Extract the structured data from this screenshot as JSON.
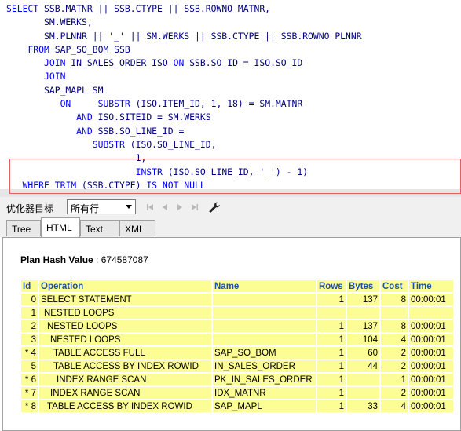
{
  "editor": {
    "lines": [
      [
        {
          "t": "SELECT ",
          "k": 1
        },
        {
          "t": "SSB.MATNR || SSB.CTYPE || SSB.ROWNO MATNR,",
          "k": 0
        }
      ],
      [
        {
          "t": "       SM.WERKS,",
          "k": 0
        }
      ],
      [
        {
          "t": "       SM.PLNNR || '_' || SM.WERKS || SSB.CTYPE || SSB.ROWNO PLNNR",
          "k": 0
        }
      ],
      [
        {
          "t": "    ",
          "k": 0
        },
        {
          "t": "FROM ",
          "k": 1
        },
        {
          "t": "SAP_SO_BOM SSB",
          "k": 0
        }
      ],
      [
        {
          "t": "       ",
          "k": 0
        },
        {
          "t": "JOIN ",
          "k": 1
        },
        {
          "t": "IN_SALES_ORDER ISO ",
          "k": 0
        },
        {
          "t": "ON ",
          "k": 1
        },
        {
          "t": "SSB.SO_ID = ISO.SO_ID",
          "k": 0
        }
      ],
      [
        {
          "t": "       ",
          "k": 0
        },
        {
          "t": "JOIN",
          "k": 1
        }
      ],
      [
        {
          "t": "       SAP_MAPL SM",
          "k": 0
        }
      ],
      [
        {
          "t": "          ",
          "k": 0
        },
        {
          "t": "ON",
          "k": 1
        },
        {
          "t": "     ",
          "k": 0
        },
        {
          "t": "SUBSTR ",
          "k": 1
        },
        {
          "t": "(ISO.ITEM_ID, 1, 18) = SM.MATNR",
          "k": 0
        }
      ],
      [
        {
          "t": "             ",
          "k": 0
        },
        {
          "t": "AND ",
          "k": 1
        },
        {
          "t": "ISO.SITEID = SM.WERKS",
          "k": 0
        }
      ],
      [
        {
          "t": "             ",
          "k": 0
        },
        {
          "t": "AND ",
          "k": 1
        },
        {
          "t": "SSB.SO_LINE_ID =",
          "k": 0
        }
      ],
      [
        {
          "t": "                ",
          "k": 0
        },
        {
          "t": "SUBSTR ",
          "k": 1
        },
        {
          "t": "(ISO.SO_LINE_ID,",
          "k": 0
        }
      ],
      [
        {
          "t": "                        1,",
          "k": 0
        }
      ],
      [
        {
          "t": "                        ",
          "k": 0
        },
        {
          "t": "INSTR ",
          "k": 1
        },
        {
          "t": "(ISO.SO_LINE_ID, '_') - 1)",
          "k": 0
        }
      ],
      [
        {
          "t": "   ",
          "k": 0
        },
        {
          "t": "WHERE TRIM ",
          "k": 1
        },
        {
          "t": "(SSB.CTYPE) ",
          "k": 0
        },
        {
          "t": "IS NOT NULL",
          "k": 1
        }
      ]
    ]
  },
  "toolbar": {
    "label": "优化器目标",
    "select_value": "所有行"
  },
  "tabs": [
    "Tree",
    "HTML",
    "Text",
    "XML"
  ],
  "active_tab": "HTML",
  "plan": {
    "hash_label": "Plan Hash Value",
    "hash_value": " : 674587087",
    "columns": [
      "Id",
      "Operation",
      "Name",
      "Rows",
      "Bytes",
      "Cost",
      "Time"
    ],
    "rows": [
      {
        "id": "0",
        "op": "SELECT STATEMENT",
        "indent": 0,
        "name": "",
        "rows": "1",
        "bytes": "137",
        "cost": "8",
        "time": "00:00:01"
      },
      {
        "id": "1",
        "op": "NESTED LOOPS",
        "indent": 1,
        "name": "",
        "rows": "",
        "bytes": "",
        "cost": "",
        "time": ""
      },
      {
        "id": "2",
        "op": "NESTED LOOPS",
        "indent": 2,
        "name": "",
        "rows": "1",
        "bytes": "137",
        "cost": "8",
        "time": "00:00:01"
      },
      {
        "id": "3",
        "op": "NESTED LOOPS",
        "indent": 3,
        "name": "",
        "rows": "1",
        "bytes": "104",
        "cost": "4",
        "time": "00:00:01"
      },
      {
        "id": "* 4",
        "op": "TABLE ACCESS FULL",
        "indent": 4,
        "name": "SAP_SO_BOM",
        "rows": "1",
        "bytes": "60",
        "cost": "2",
        "time": "00:00:01"
      },
      {
        "id": "5",
        "op": "TABLE ACCESS BY INDEX ROWID",
        "indent": 4,
        "name": "IN_SALES_ORDER",
        "rows": "1",
        "bytes": "44",
        "cost": "2",
        "time": "00:00:01"
      },
      {
        "id": "* 6",
        "op": "INDEX RANGE SCAN",
        "indent": 5,
        "name": "PK_IN_SALES_ORDER",
        "rows": "1",
        "bytes": "",
        "cost": "1",
        "time": "00:00:01"
      },
      {
        "id": "* 7",
        "op": "INDEX RANGE SCAN",
        "indent": 3,
        "name": "IDX_MATNR",
        "rows": "1",
        "bytes": "",
        "cost": "2",
        "time": "00:00:01"
      },
      {
        "id": "* 8",
        "op": "TABLE ACCESS BY INDEX ROWID",
        "indent": 2,
        "name": "SAP_MAPL",
        "rows": "1",
        "bytes": "33",
        "cost": "4",
        "time": "00:00:01"
      }
    ],
    "highlighted_ids": [
      "* 7",
      "* 8"
    ]
  },
  "colors": {
    "keyword": "#0000ff",
    "identifier": "#000080",
    "table_cell": "#fdfd96",
    "table_header_text": "#1f4fa0",
    "highlight_border": "#e06060"
  },
  "icons": [
    "first-icon",
    "prev-icon",
    "next-icon",
    "last-icon",
    "wrench-icon",
    "dropdown-arrow-icon"
  ]
}
